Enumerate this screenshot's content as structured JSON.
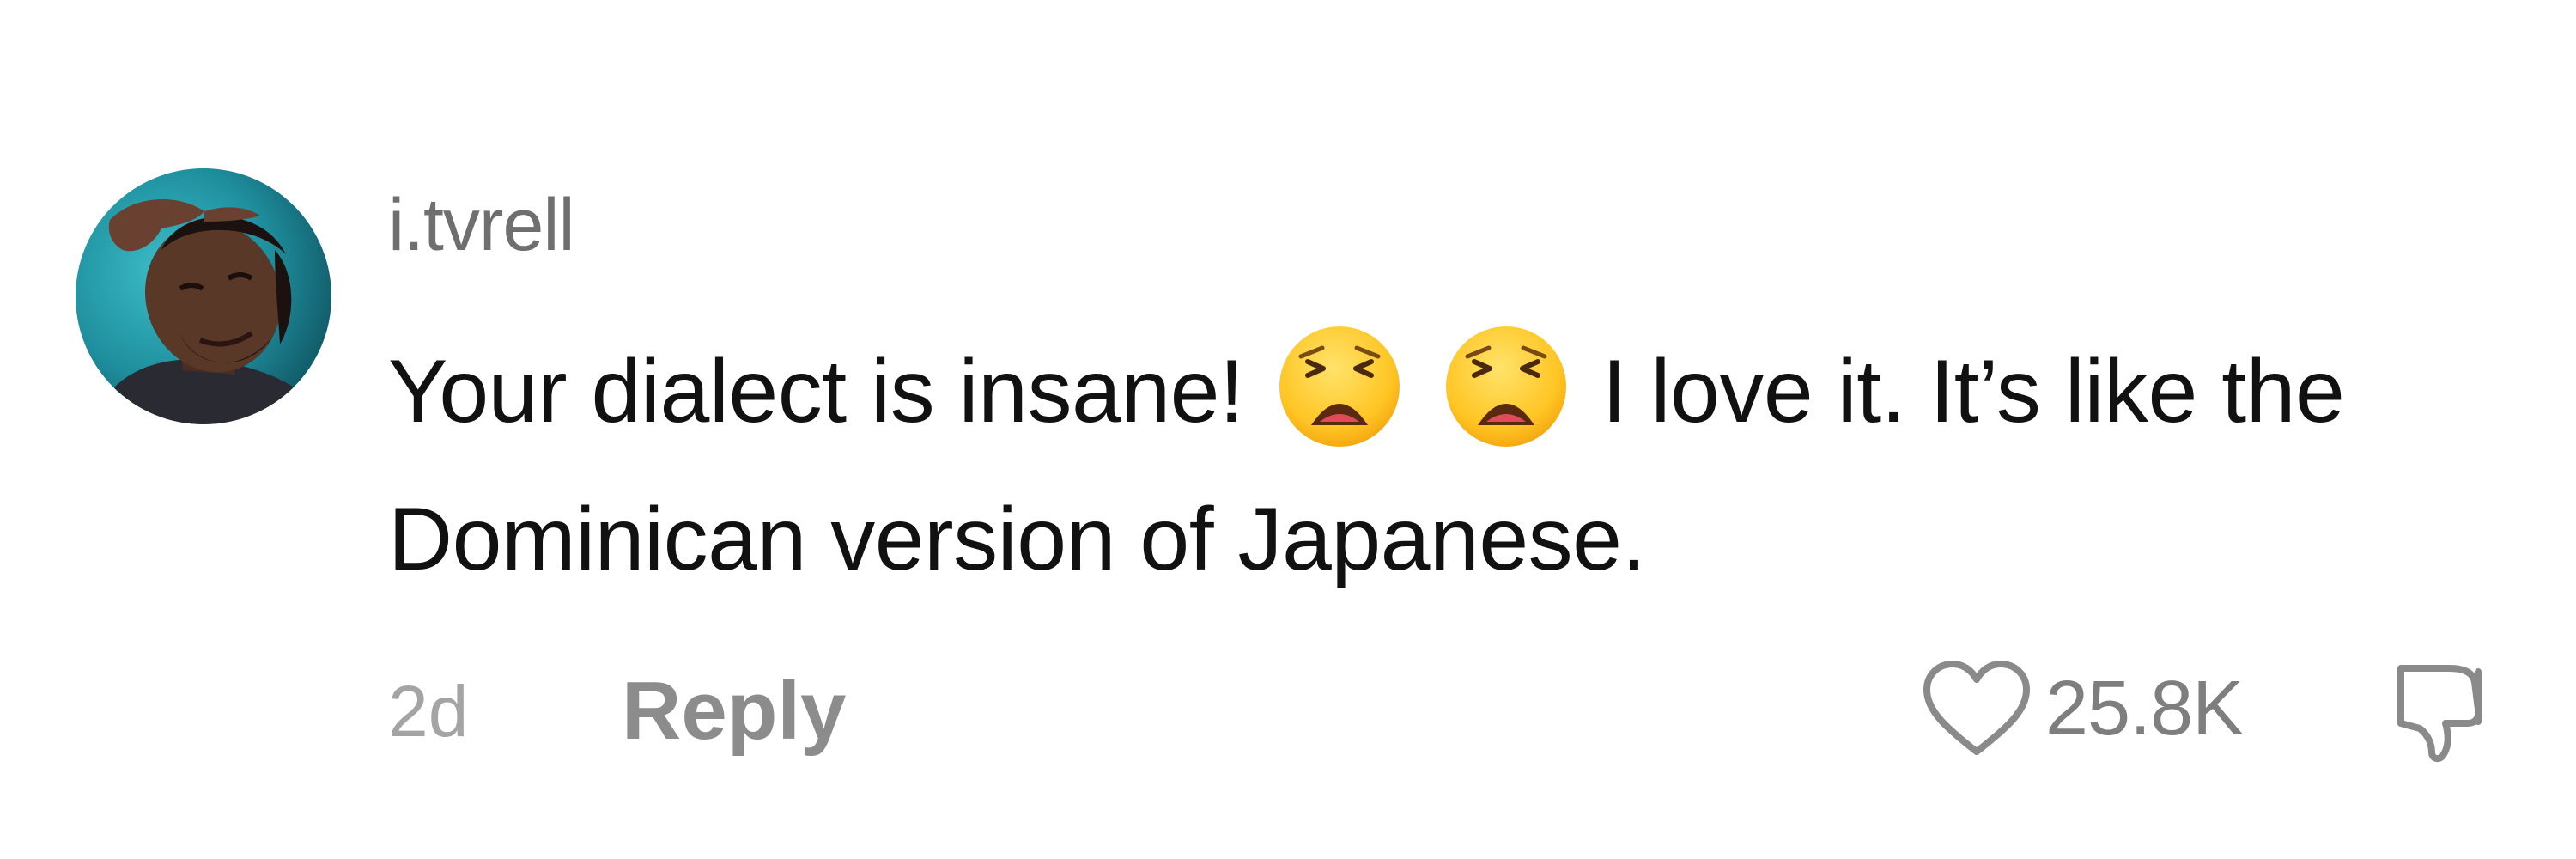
{
  "comment": {
    "username": "i.tvrell",
    "text_part1": "Your dialect is insane!",
    "emoji_1": "weary-face",
    "emoji_2": "weary-face",
    "text_part2": "I love it. It’s like the Dominican version of Japanese.",
    "timestamp": "2d",
    "reply_label": "Reply",
    "like_count": "25.8K",
    "icons": {
      "like": "heart-outline-icon",
      "dislike": "thumbs-down-outline-icon"
    },
    "colors": {
      "username": "#6f6f6f",
      "text": "#111111",
      "timestamp": "#a4a4a4",
      "reply": "#8c8c8c",
      "like_count": "#7e7e7e",
      "icon_stroke": "#8a8a8a"
    }
  }
}
